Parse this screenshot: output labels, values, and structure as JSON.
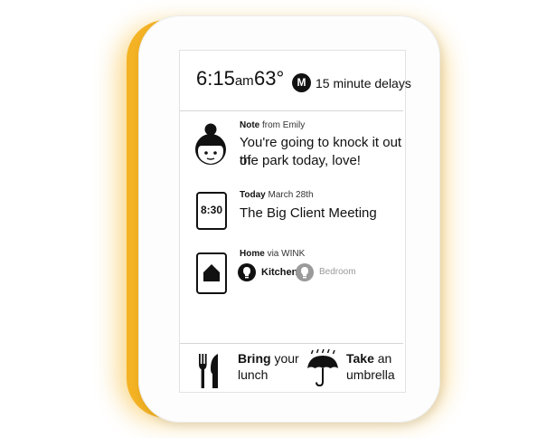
{
  "header": {
    "time": "6:15",
    "time_unit": "am",
    "temperature": "63°",
    "transit_badge": "M",
    "transit_status": "15 minute delays"
  },
  "cards": [
    {
      "icon": "girl-face-icon",
      "title": "Note",
      "meta": "from Emily",
      "body_line1": "You're going to knock it out of",
      "body_line2": "the park today, love!"
    },
    {
      "icon": "clock-icon",
      "icon_text": "8:30",
      "title": "Today",
      "meta": "March 28th",
      "body_line1": "The Big Client Meeting"
    },
    {
      "icon": "home-icon",
      "title": "Home",
      "meta": "via WINK",
      "lights": [
        {
          "label": "Kitchen",
          "state": "on"
        },
        {
          "label": "Bedroom",
          "state": "off"
        }
      ]
    }
  ],
  "bottom": {
    "lunch": {
      "bold": "Bring",
      "rest1": " your",
      "rest2": "lunch",
      "icon": "utensils-icon"
    },
    "umbrella": {
      "bold": "Take",
      "rest1": " an",
      "rest2": "umbrella",
      "icon": "umbrella-icon"
    }
  },
  "colors": {
    "glow": "#f4b324",
    "device": "#fdfdfd",
    "ink": "#111111",
    "off": "#9a9a9a"
  }
}
